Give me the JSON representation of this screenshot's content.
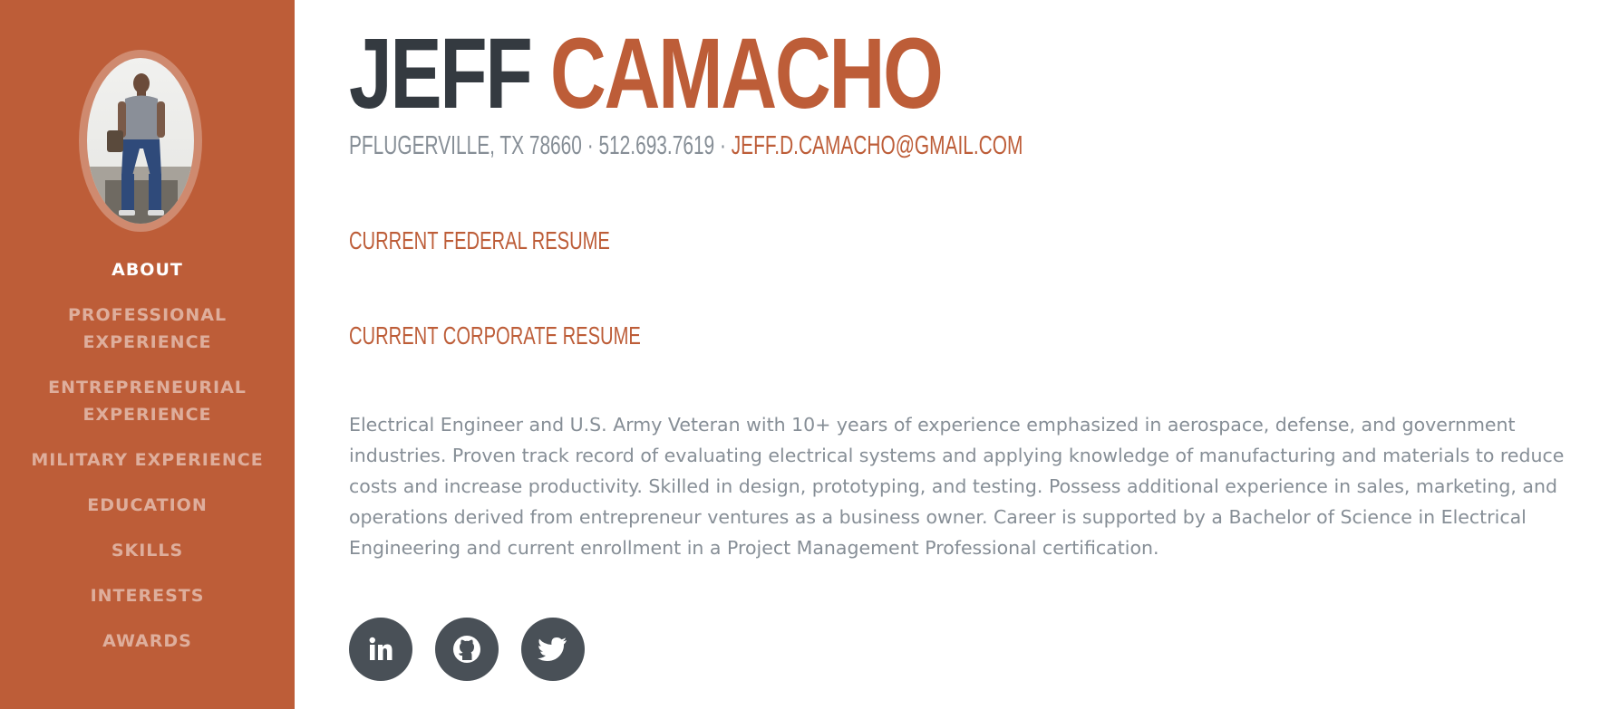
{
  "sidebar": {
    "nav_items": [
      {
        "label": "About",
        "active": true
      },
      {
        "label": "Professional Experience",
        "active": false
      },
      {
        "label": "Entrepreneurial Experience",
        "active": false
      },
      {
        "label": "Military Experience",
        "active": false
      },
      {
        "label": "Education",
        "active": false
      },
      {
        "label": "Skills",
        "active": false
      },
      {
        "label": "Interests",
        "active": false
      },
      {
        "label": "Awards",
        "active": false
      }
    ]
  },
  "about": {
    "first_name": "JEFF",
    "last_name": "CAMACHO",
    "contact_text": "PFLUGERVILLE, TX 78660 · 512.693.7619 · ",
    "email": "JEFF.D.CAMACHO@GMAIL.COM",
    "federal_resume": "CURRENT FEDERAL RESUME",
    "corporate_resume": "CURRENT CORPORATE RESUME",
    "summary": "Electrical Engineer and U.S. Army Veteran with 10+ years of experience emphasized in aerospace, defense, and government industries. Proven track record of evaluating electrical systems and applying knowledge of manufacturing and materials to reduce costs and increase productivity. Skilled in design, prototyping, and testing. Possess additional experience in sales, marketing, and operations derived from entrepreneur ventures as a business owner. Career is supported by a Bachelor of Science in Electrical Engineering and current enrollment in a Project Management Professional certification."
  },
  "social": [
    "linkedin-icon",
    "github-icon",
    "twitter-icon"
  ],
  "colors": {
    "primary": "#bd5d38",
    "dark": "#343a40",
    "muted": "#868e96",
    "icon_bg": "#495057"
  }
}
